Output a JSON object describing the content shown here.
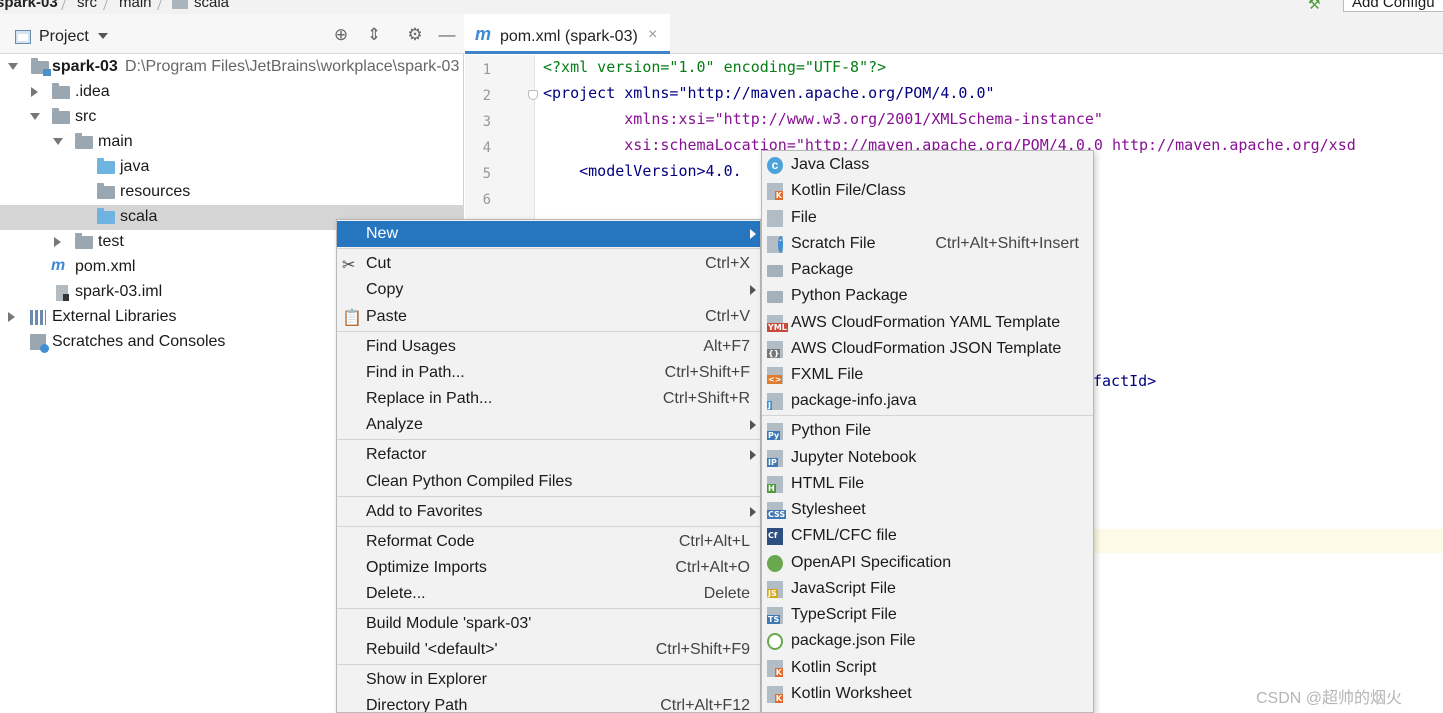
{
  "topbar": {
    "crumbs": [
      "spark-03",
      "src",
      "main",
      "scala"
    ],
    "add_config_label": "Add Configu"
  },
  "project": {
    "title": "Project",
    "tree": [
      {
        "label": "spark-03",
        "path": "D:\\Program Files\\JetBrains\\workplace\\spark-03"
      },
      {
        "label": ".idea"
      },
      {
        "label": "src"
      },
      {
        "label": "main"
      },
      {
        "label": "java"
      },
      {
        "label": "resources"
      },
      {
        "label": "scala"
      },
      {
        "label": "test"
      },
      {
        "label": "pom.xml"
      },
      {
        "label": "spark-03.iml"
      },
      {
        "label": "External Libraries"
      },
      {
        "label": "Scratches and Consoles"
      }
    ]
  },
  "editor": {
    "tab_label": "pom.xml (spark-03)",
    "tab_close": "×",
    "line_numbers": [
      "1",
      "2",
      "3",
      "4",
      "5",
      "6"
    ],
    "lines": [
      "<?xml version=\"1.0\" encoding=\"UTF-8\"?>",
      "<project xmlns=\"http://maven.apache.org/POM/4.0.0\"",
      "         xmlns:xsi=\"http://www.w3.org/2001/XMLSchema-instance\"",
      "         xsi:schemaLocation=\"http://maven.apache.org/POM/4.0.0 http://maven.apache.org/xsd",
      "    <modelVersion>4.0."
    ],
    "tail_text": "factId>"
  },
  "context_menu": {
    "items": [
      {
        "label": "New",
        "shortcut": "",
        "submenu": true,
        "active": true
      },
      {
        "label": "Cut",
        "shortcut": "Ctrl+X"
      },
      {
        "label": "Copy",
        "shortcut": "",
        "submenu": true
      },
      {
        "label": "Paste",
        "shortcut": "Ctrl+V"
      },
      {
        "label": "Find Usages",
        "shortcut": "Alt+F7"
      },
      {
        "label": "Find in Path...",
        "shortcut": "Ctrl+Shift+F"
      },
      {
        "label": "Replace in Path...",
        "shortcut": "Ctrl+Shift+R"
      },
      {
        "label": "Analyze",
        "shortcut": "",
        "submenu": true
      },
      {
        "label": "Refactor",
        "shortcut": "",
        "submenu": true
      },
      {
        "label": "Clean Python Compiled Files",
        "shortcut": ""
      },
      {
        "label": "Add to Favorites",
        "shortcut": "",
        "submenu": true
      },
      {
        "label": "Reformat Code",
        "shortcut": "Ctrl+Alt+L"
      },
      {
        "label": "Optimize Imports",
        "shortcut": "Ctrl+Alt+O"
      },
      {
        "label": "Delete...",
        "shortcut": "Delete"
      },
      {
        "label": "Build Module 'spark-03'",
        "shortcut": ""
      },
      {
        "label": "Rebuild '<default>'",
        "shortcut": "Ctrl+Shift+F9"
      },
      {
        "label": "Show in Explorer",
        "shortcut": ""
      },
      {
        "label": "Directory Path",
        "shortcut": "Ctrl+Alt+F12"
      }
    ]
  },
  "new_submenu": {
    "items": [
      {
        "label": "Java Class",
        "icon": "java-class-icon"
      },
      {
        "label": "Kotlin File/Class",
        "icon": "kotlin-file-icon"
      },
      {
        "label": "File",
        "icon": "file-icon"
      },
      {
        "label": "Scratch File",
        "shortcut": "Ctrl+Alt+Shift+Insert",
        "icon": "scratch-file-icon"
      },
      {
        "label": "Package",
        "icon": "package-icon"
      },
      {
        "label": "Python Package",
        "icon": "python-package-icon"
      },
      {
        "label": "AWS CloudFormation YAML Template",
        "icon": "yaml-icon",
        "badge": "YML"
      },
      {
        "label": "AWS CloudFormation JSON Template",
        "icon": "json-template-icon",
        "badge": "{}"
      },
      {
        "label": "FXML File",
        "icon": "fxml-icon",
        "badge": "<>"
      },
      {
        "label": "package-info.java",
        "icon": "package-info-icon",
        "badge": "J"
      },
      {
        "label": "Python File",
        "icon": "python-file-icon"
      },
      {
        "label": "Jupyter Notebook",
        "icon": "jupyter-icon",
        "badge": "IP"
      },
      {
        "label": "HTML File",
        "icon": "html-file-icon",
        "badge": "H"
      },
      {
        "label": "Stylesheet",
        "icon": "stylesheet-icon",
        "badge": "CSS"
      },
      {
        "label": "CFML/CFC file",
        "icon": "cfml-icon",
        "badge": "Cf"
      },
      {
        "label": "OpenAPI Specification",
        "icon": "openapi-icon"
      },
      {
        "label": "JavaScript File",
        "icon": "javascript-file-icon",
        "badge": "JS"
      },
      {
        "label": "TypeScript File",
        "icon": "typescript-file-icon",
        "badge": "TS"
      },
      {
        "label": "package.json File",
        "icon": "package-json-icon"
      },
      {
        "label": "Kotlin Script",
        "icon": "kotlin-script-icon"
      },
      {
        "label": "Kotlin Worksheet",
        "icon": "kotlin-worksheet-icon"
      }
    ]
  },
  "watermark": "CSDN @超帅的烟火",
  "colors": {
    "selection": "#2675bf",
    "accent": "#4083c9"
  }
}
